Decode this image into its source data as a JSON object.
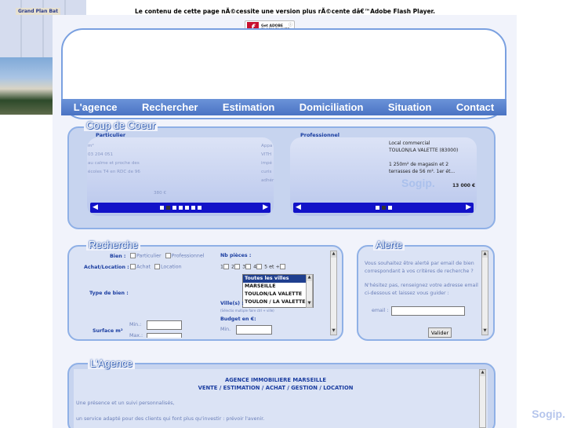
{
  "flash_message": "Le contenu de cette page nÃ©cessite une version plus rÃ©cente dâ€™Adobe Flash Player.",
  "flash_button": {
    "line1": "Get ADOBE",
    "line2": "FLASH PLAYER",
    "logo": "f"
  },
  "nav": [
    "L'agence",
    "Rechercher",
    "Estimation",
    "Domiciliation",
    "Situation",
    "Contact"
  ],
  "coup_de_coeur": {
    "title": "Coup de Coeur",
    "particulier": {
      "label": "Particulier",
      "lines": [
        "m²",
        "03 204 051",
        "au calme et proche des",
        "écoles T4 en RDC de 96",
        "380 €"
      ],
      "side_text": [
        "Appa",
        "VITH",
        "impé",
        "curis",
        "adhér"
      ],
      "brand": "Sogip."
    },
    "professionnel": {
      "label": "Professionnel",
      "lines": [
        "Local commercial",
        "TOULON/LA VALETTE (83000)",
        "1 250m² de magasin et 2",
        "terrasses de 56 m². 1er ét...",
        "13 000 €"
      ],
      "photo_sign": "Grand Plan Bat",
      "brand": "Sogip."
    }
  },
  "recherche": {
    "title": "Recherche",
    "bien_label": "Bien :",
    "bien_options": [
      "Particulier",
      "Professionnel"
    ],
    "achat_label": "Achat/Location :",
    "achat_options": [
      "Achat",
      "Location"
    ],
    "nb_pieces_label": "Nb pièces :",
    "nb_pieces": [
      "1",
      "2",
      "3",
      "4",
      "5 et +"
    ],
    "type_label": "Type de bien :",
    "villes": [
      "Toutes les villes",
      "MARSEILLE",
      "TOULON/LA VALETTE",
      "TOULON / LA VALETTE"
    ],
    "ville_label": "Ville(s) :",
    "ville_hint": "(Sélectio multiple faire ctrl + ville)",
    "budget_label": "Budget en €:",
    "min_label": "Min.",
    "surface_label": "Surface m²",
    "surface_min": "Min.:",
    "surface_max": "Max.:"
  },
  "alerte": {
    "title": "Alerte",
    "text1": [
      "Vous souhaitez être alerté par email de bien",
      "correspondant à vos critères de recherche ?"
    ],
    "text2": [
      "N'hésitez pas, renseignez votre adresse email",
      "ci-dessous et laissez vous guider :"
    ],
    "email_label": "email :",
    "button": "Valider"
  },
  "agence": {
    "title": "L'Agence",
    "heading1": "AGENCE IMMOBILIERE MARSEILLE",
    "heading2": "VENTE / ESTIMATION / ACHAT / GESTION / LOCATION",
    "p1": "Une présence et un suivi personnalisés,",
    "p2": "un service adapté pour des clients qui font plus qu'investir : prévoir l'avenir."
  }
}
